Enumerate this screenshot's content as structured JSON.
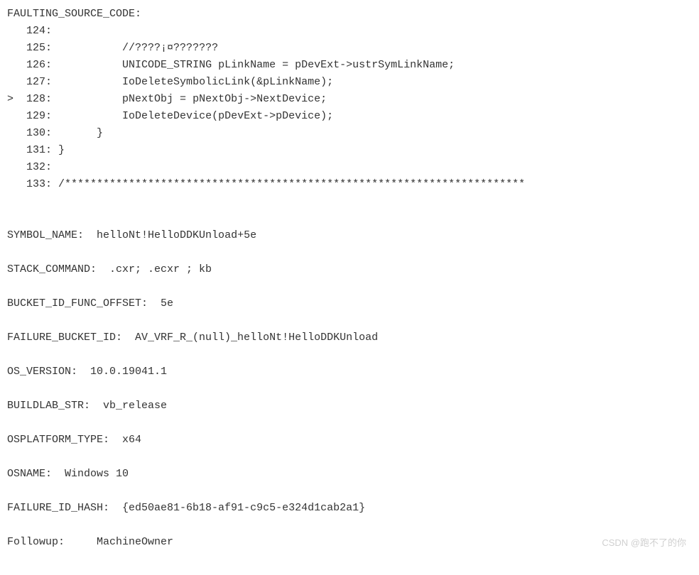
{
  "header": "FAULTING_SOURCE_CODE:",
  "code_lines": [
    {
      "prefix": "   ",
      "lineno": "124:",
      "code": ""
    },
    {
      "prefix": "   ",
      "lineno": "125:",
      "code": "           //????¡¤???????"
    },
    {
      "prefix": "   ",
      "lineno": "126:",
      "code": "           UNICODE_STRING pLinkName = pDevExt->ustrSymLinkName;"
    },
    {
      "prefix": "   ",
      "lineno": "127:",
      "code": "           IoDeleteSymbolicLink(&pLinkName);"
    },
    {
      "prefix": ">  ",
      "lineno": "128:",
      "code": "           pNextObj = pNextObj->NextDevice;"
    },
    {
      "prefix": "   ",
      "lineno": "129:",
      "code": "           IoDeleteDevice(pDevExt->pDevice);"
    },
    {
      "prefix": "   ",
      "lineno": "130:",
      "code": "       }"
    },
    {
      "prefix": "   ",
      "lineno": "131:",
      "code": " }"
    },
    {
      "prefix": "   ",
      "lineno": "132:",
      "code": ""
    },
    {
      "prefix": "   ",
      "lineno": "133:",
      "code": " /************************************************************************"
    }
  ],
  "fields": [
    {
      "label": "SYMBOL_NAME:",
      "value": "  helloNt!HelloDDKUnload+5e"
    },
    {
      "label": "STACK_COMMAND:",
      "value": "  .cxr; .ecxr ; kb"
    },
    {
      "label": "BUCKET_ID_FUNC_OFFSET:",
      "value": "  5e"
    },
    {
      "label": "FAILURE_BUCKET_ID:",
      "value": "  AV_VRF_R_(null)_helloNt!HelloDDKUnload"
    },
    {
      "label": "OS_VERSION:",
      "value": "  10.0.19041.1"
    },
    {
      "label": "BUILDLAB_STR:",
      "value": "  vb_release"
    },
    {
      "label": "OSPLATFORM_TYPE:",
      "value": "  x64"
    },
    {
      "label": "OSNAME:",
      "value": "  Windows 10"
    },
    {
      "label": "FAILURE_ID_HASH:",
      "value": "  {ed50ae81-6b18-af91-c9c5-e324d1cab2a1}"
    },
    {
      "label": "Followup:",
      "value": "     MachineOwner"
    }
  ],
  "watermark": "CSDN @跑不了的你"
}
